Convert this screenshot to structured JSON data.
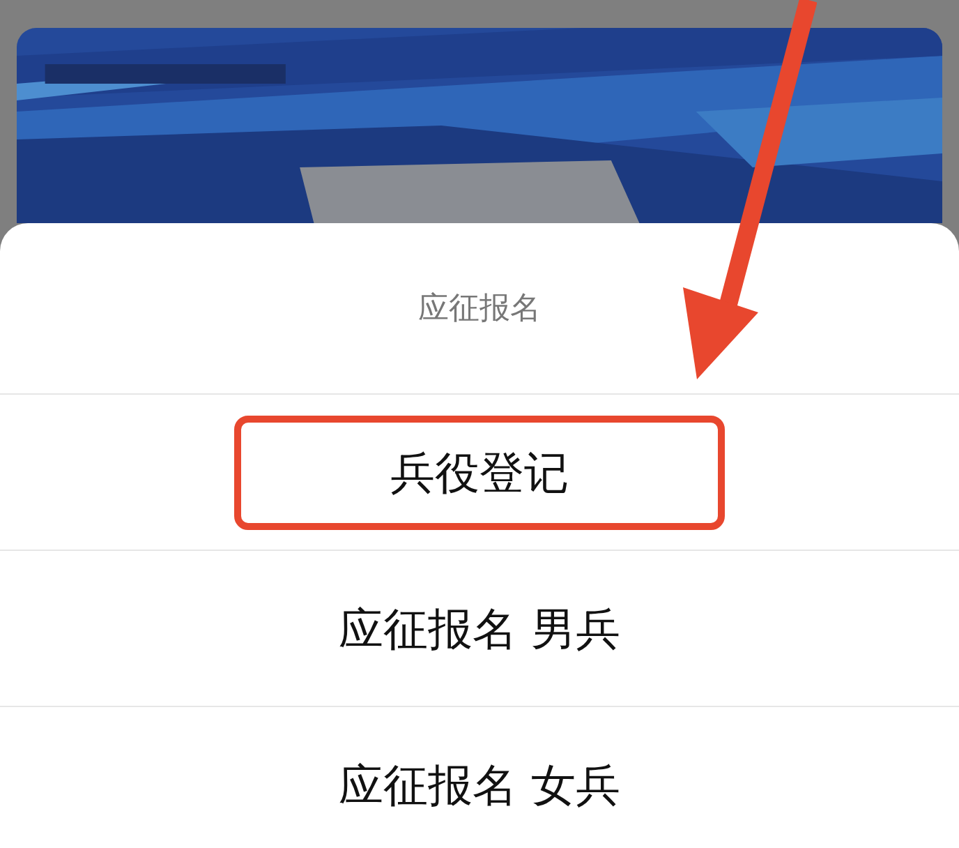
{
  "action_sheet": {
    "title": "应征报名",
    "items": [
      {
        "label": "兵役登记",
        "highlighted": true
      },
      {
        "label": "应征报名 男兵",
        "highlighted": false
      },
      {
        "label": "应征报名 女兵",
        "highlighted": false
      }
    ]
  }
}
